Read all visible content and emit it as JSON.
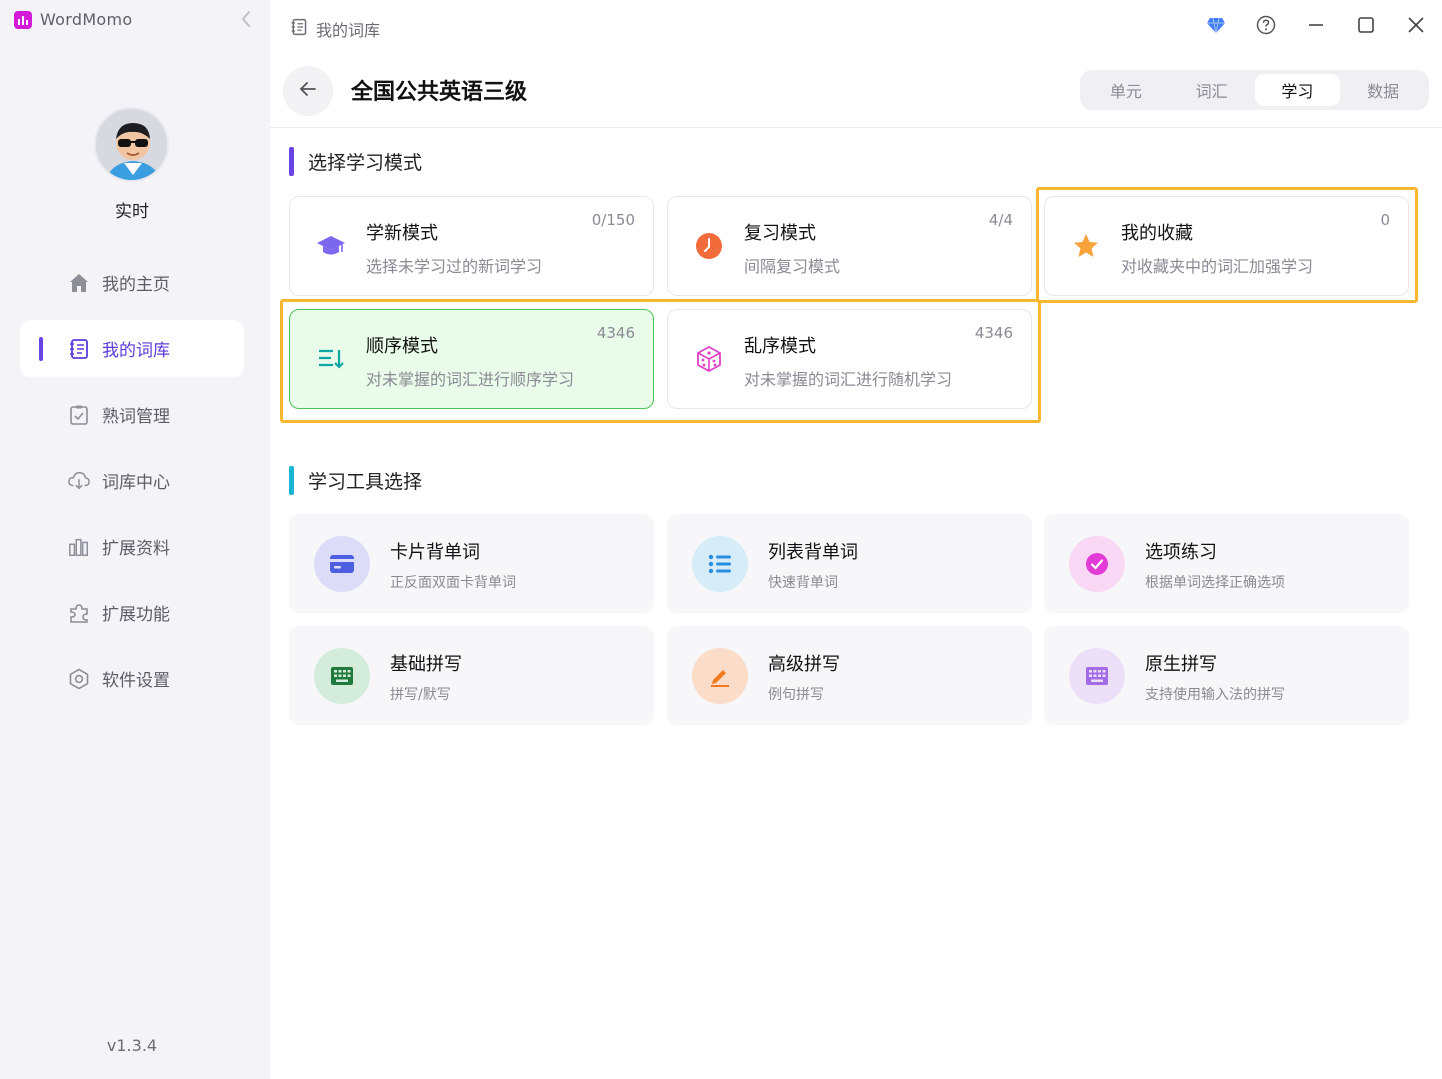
{
  "app": {
    "name": "WordMomo",
    "version": "v1.3.4"
  },
  "user": {
    "name": "实时"
  },
  "sidebar": {
    "items": [
      {
        "label": "我的主页",
        "icon": "home-icon"
      },
      {
        "label": "我的词库",
        "icon": "book-icon",
        "active": true
      },
      {
        "label": "熟词管理",
        "icon": "clipboard-check-icon"
      },
      {
        "label": "词库中心",
        "icon": "cloud-download-icon"
      },
      {
        "label": "扩展资料",
        "icon": "books-icon"
      },
      {
        "label": "扩展功能",
        "icon": "puzzle-icon"
      },
      {
        "label": "软件设置",
        "icon": "hex-gear-icon"
      }
    ]
  },
  "header": {
    "breadcrumb": "我的词库",
    "title": "全国公共英语三级",
    "tabs": [
      {
        "label": "单元"
      },
      {
        "label": "词汇"
      },
      {
        "label": "学习",
        "active": true
      },
      {
        "label": "数据"
      }
    ]
  },
  "modes": {
    "section_title": "选择学习模式",
    "cards": [
      {
        "title": "学新模式",
        "desc": "选择未学习过的新词学习",
        "count": "0/150",
        "icon": "graduation-cap-icon"
      },
      {
        "title": "复习模式",
        "desc": "间隔复习模式",
        "count": "4/4",
        "icon": "clock-icon"
      },
      {
        "title": "我的收藏",
        "desc": "对收藏夹中的词汇加强学习",
        "count": "0",
        "icon": "star-icon"
      },
      {
        "title": "顺序模式",
        "desc": "对未掌握的词汇进行顺序学习",
        "count": "4346",
        "icon": "sort-list-icon",
        "selected": true
      },
      {
        "title": "乱序模式",
        "desc": "对未掌握的词汇进行随机学习",
        "count": "4346",
        "icon": "dice-icon"
      }
    ]
  },
  "tools": {
    "section_title": "学习工具选择",
    "cards": [
      {
        "title": "卡片背单词",
        "desc": "正反面双面卡背单词",
        "icon": "card-icon"
      },
      {
        "title": "列表背单词",
        "desc": "快速背单词",
        "icon": "list-icon"
      },
      {
        "title": "选项练习",
        "desc": "根据单词选择正确选项",
        "icon": "check-circle-icon"
      },
      {
        "title": "基础拼写",
        "desc": "拼写/默写",
        "icon": "keyboard-icon"
      },
      {
        "title": "高级拼写",
        "desc": "例句拼写",
        "icon": "pencil-icon"
      },
      {
        "title": "原生拼写",
        "desc": "支持使用输入法的拼写",
        "icon": "keyboard-alt-icon"
      }
    ]
  },
  "colors": {
    "accent": "#6a45e6",
    "highlight": "#f7b731",
    "selected_bg": "#e9fbe9",
    "selected_border": "#4cc454"
  }
}
